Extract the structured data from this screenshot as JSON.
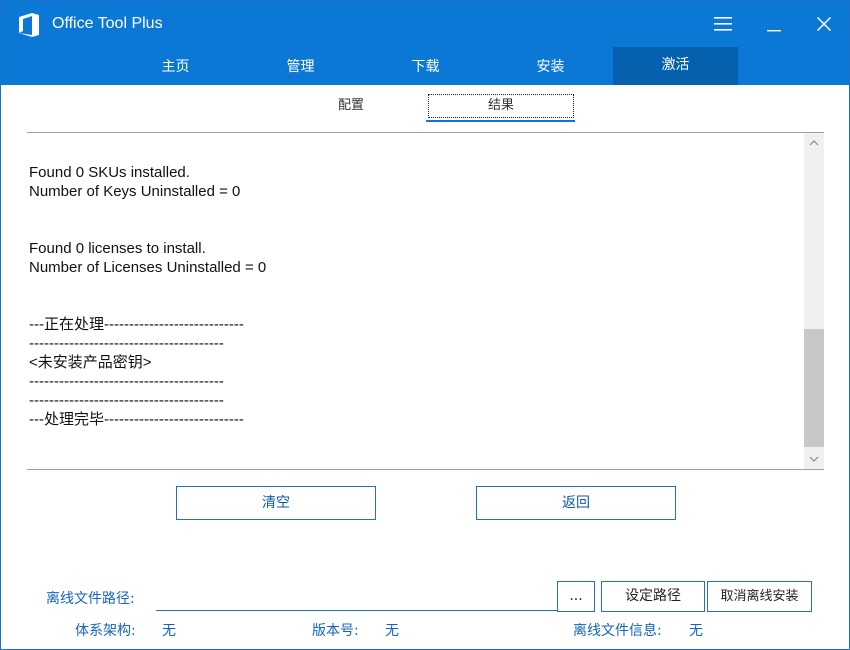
{
  "app": {
    "title": "Office Tool Plus"
  },
  "nav": {
    "tabs": [
      {
        "label": "主页"
      },
      {
        "label": "管理"
      },
      {
        "label": "下载"
      },
      {
        "label": "安装"
      },
      {
        "label": "激活"
      }
    ],
    "active": "激活"
  },
  "subtabs": {
    "config": "配置",
    "result": "结果"
  },
  "result": {
    "text": "Found 0 SKUs installed.\nNumber of Keys Uninstalled = 0\n\n\nFound 0 licenses to install.\nNumber of Licenses Uninstalled = 0\n\n\n---正在处理----------------------------\n---------------------------------------\n<未安装产品密钥>\n---------------------------------------\n---------------------------------------\n---处理完毕----------------------------"
  },
  "buttons": {
    "clear": "清空",
    "back": "返回",
    "browse": "...",
    "set_path": "设定路径",
    "cancel_offline": "取消离线安装"
  },
  "offline": {
    "path_label": "离线文件路径:",
    "path_value": "",
    "arch_label": "体系架构:",
    "arch_value": "无",
    "version_label": "版本号:",
    "version_value": "无",
    "info_label": "离线文件信息:",
    "info_value": "无"
  },
  "colors": {
    "titlebar": "#0a78d4",
    "active_tab": "#0561ad",
    "accent_text": "#1565b8"
  }
}
